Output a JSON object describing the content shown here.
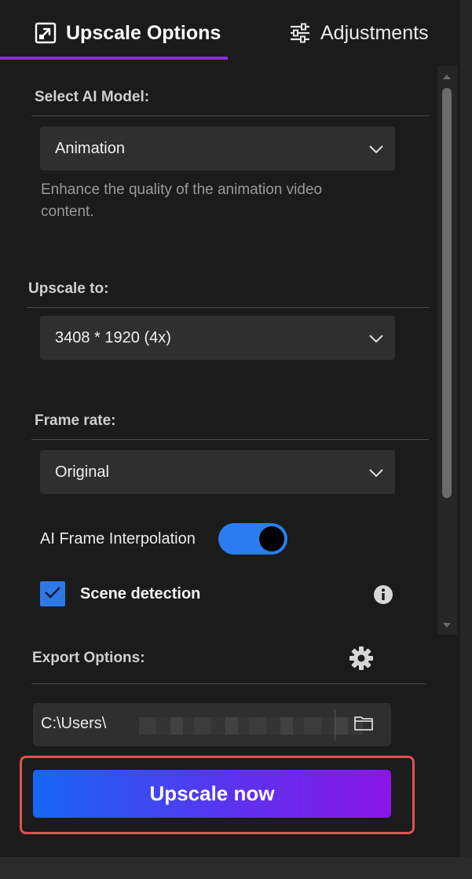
{
  "tabs": {
    "upscale_label": "Upscale Options",
    "adjust_label": "Adjustments",
    "accent_color": "#8a2be2"
  },
  "ai_model": {
    "title": "Select AI Model:",
    "selected": "Animation",
    "helper": "Enhance the quality of the animation video content."
  },
  "upscale_to": {
    "title": "Upscale to:",
    "selected": "3408 * 1920 (4x)"
  },
  "frame_rate": {
    "title": "Frame rate:",
    "selected": "Original"
  },
  "interpolation": {
    "label": "AI Frame Interpolation",
    "enabled": true
  },
  "scene_detection": {
    "label": "Scene detection",
    "checked": true
  },
  "export": {
    "title": "Export Options:",
    "path": "C:\\Users\\"
  },
  "action": {
    "label": "Upscale now"
  },
  "icons": [
    "upscale-icon",
    "sliders-icon",
    "chevron-down-icon",
    "info-icon",
    "gear-icon",
    "folder-icon",
    "checkmark-icon"
  ]
}
